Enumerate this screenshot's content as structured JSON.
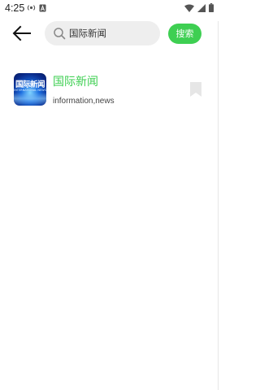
{
  "status_bar": {
    "time": "4:25",
    "left_icons": [
      "radio-signal-icon",
      "notification-a-icon"
    ],
    "right_icons": [
      "wifi-icon",
      "cellular-icon",
      "battery-icon"
    ]
  },
  "search": {
    "query": "国际新闻",
    "button_label": "搜索"
  },
  "results": [
    {
      "icon_text": "国际新闻",
      "icon_subtext": "INTERNATIONAL NEWS",
      "title": "国际新闻",
      "tags": "information,news"
    }
  ],
  "colors": {
    "accent": "#3ecf52",
    "search_bg": "#eeeeee",
    "icon_blue": "#1b6de0",
    "bookmark": "#e6e6e6"
  }
}
